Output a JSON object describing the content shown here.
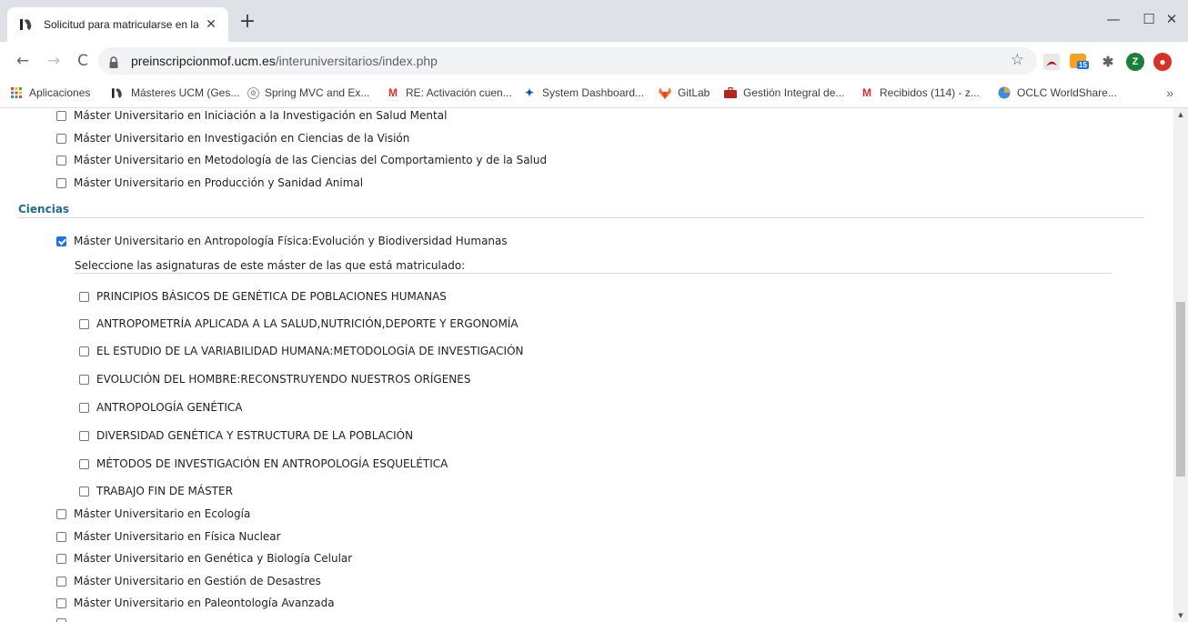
{
  "browser": {
    "tab_title": "Solicitud para matricularse en la I",
    "new_tab": "+",
    "url_host": "preinscripcionmof.ucm.es",
    "url_path": "/interuniversitarios/index.php",
    "profile_initial": "Z",
    "rss_badge": "15"
  },
  "bookmarks": [
    {
      "label": "Aplicaciones",
      "icon": "apps-grid-icon"
    },
    {
      "label": "Másteres UCM (Ges...",
      "icon": "ucm-logo-icon"
    },
    {
      "label": "Spring MVC and Ex...",
      "icon": "spring-icon"
    },
    {
      "label": "RE: Activación cuen...",
      "icon": "gmail-icon"
    },
    {
      "label": "System Dashboard...",
      "icon": "jira-icon"
    },
    {
      "label": "GitLab",
      "icon": "gitlab-icon"
    },
    {
      "label": "Gestión Integral de...",
      "icon": "briefcase-icon"
    },
    {
      "label": "Recibidos (114) - z...",
      "icon": "gmail-icon"
    },
    {
      "label": "OCLC WorldShare...",
      "icon": "oclc-icon"
    }
  ],
  "masters_top": [
    {
      "label": "Máster Universitario en Iniciación a la Investigación en Salud Mental",
      "checked": false
    },
    {
      "label": "Máster Universitario en Investigación en Ciencias de la Visión",
      "checked": false
    },
    {
      "label": "Máster Universitario en Metodología de las Ciencias del Comportamiento y de la Salud",
      "checked": false
    },
    {
      "label": "Máster Universitario en Producción y Sanidad Animal",
      "checked": false
    }
  ],
  "section": {
    "title": "Ciencias"
  },
  "selected_master": {
    "label": "Máster Universitario en Antropología Física:Evolución y Biodiversidad Humanas",
    "checked": true
  },
  "subjects_prompt": "Seleccione las asignaturas de este máster de las que está matriculado:",
  "subjects": [
    "PRINCIPIOS BÁSICOS DE GENÉTICA DE POBLACIONES HUMANAS",
    "ANTROPOMETRÍA APLICADA A LA SALUD,NUTRICIÓN,DEPORTE Y ERGONOMÍA",
    "EL ESTUDIO DE LA VARIABILIDAD HUMANA:METODOLOGÍA DE INVESTIGACIÓN",
    "EVOLUCIÓN DEL HOMBRE:RECONSTRUYENDO NUESTROS ORÍGENES",
    "ANTROPOLOGÍA GENÉTICA",
    "DIVERSIDAD GENÉTICA Y ESTRUCTURA DE LA POBLACIÓN",
    "MÉTODOS DE INVESTIGACIÓN EN ANTROPOLOGÍA ESQUELÉTICA",
    "TRABAJO FIN DE MÁSTER"
  ],
  "masters_bottom": [
    "Máster Universitario en Ecología",
    "Máster Universitario en Física Nuclear",
    "Máster Universitario en Genética y Biología Celular",
    "Máster Universitario en Gestión de Desastres",
    "Máster Universitario en Paleontología Avanzada"
  ],
  "colors": {
    "section_title": "#1f6e8c",
    "checkbox_checked": "#1a73e8"
  }
}
